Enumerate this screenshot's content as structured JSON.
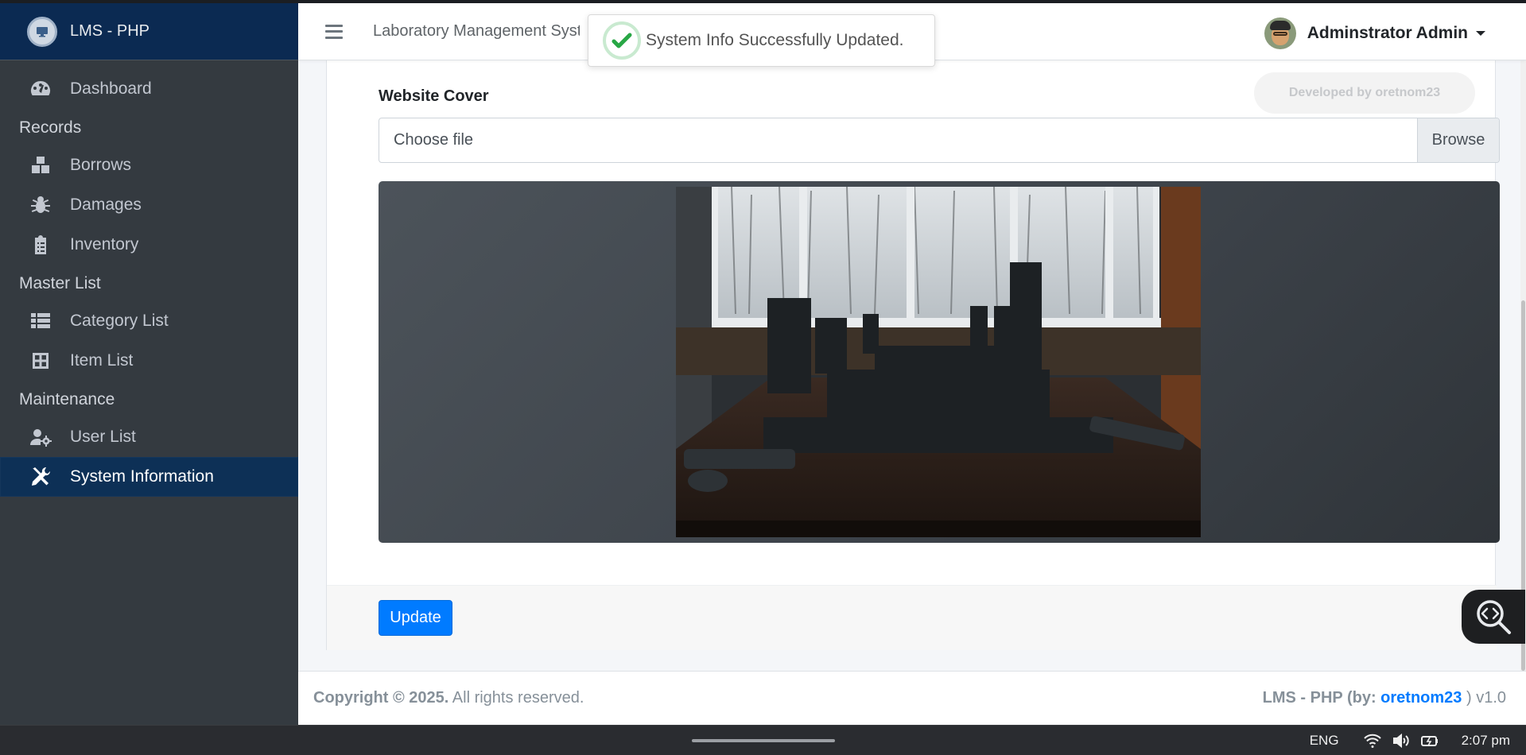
{
  "sidebar": {
    "brand": "LMS - PHP",
    "dashboard": "Dashboard",
    "sections": {
      "records": "Records",
      "master_list": "Master List",
      "maintenance": "Maintenance"
    },
    "items": {
      "borrows": "Borrows",
      "damages": "Damages",
      "inventory": "Inventory",
      "category_list": "Category List",
      "item_list": "Item List",
      "user_list": "User List",
      "system_information": "System Information"
    },
    "active": "system_information"
  },
  "header": {
    "title": "Laboratory Management System",
    "user": "Adminstrator Admin"
  },
  "toast": {
    "message": "System Info Successfully Updated."
  },
  "form": {
    "cover_label": "Website Cover",
    "file_placeholder": "Choose file",
    "browse_label": "Browse",
    "update_label": "Update",
    "developer_badge": "Developed by oretnom23"
  },
  "footer": {
    "copyright_bold": "Copyright © 2025.",
    "copyright_rest": " All rights reserved.",
    "app_bold": "LMS - PHP (by: ",
    "author": "oretnom23",
    "version": " ) v1.0"
  },
  "taskbar": {
    "language": "ENG",
    "time": "2:07 pm"
  },
  "colors": {
    "accent": "#007bff",
    "sidebar_bg": "#343a40",
    "brand_bg": "#0b2a52",
    "active_bg": "#0d3056",
    "success": "#28a745"
  }
}
